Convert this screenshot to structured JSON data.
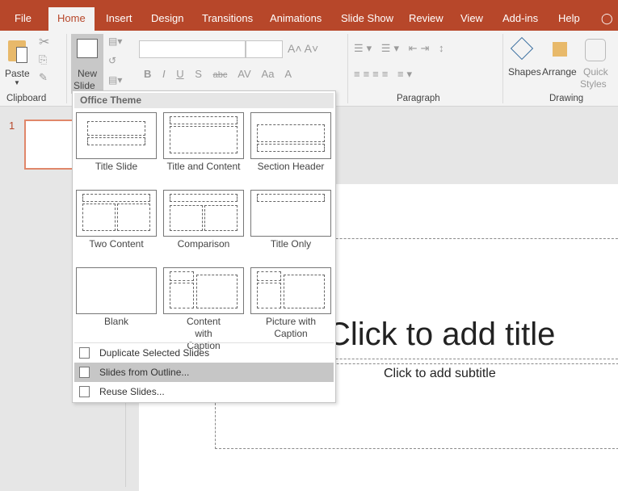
{
  "tabs": [
    "File",
    "Home",
    "Insert",
    "Design",
    "Transitions",
    "Animations",
    "Slide Show",
    "Review",
    "View",
    "Add-ins",
    "Help"
  ],
  "ribbon": {
    "paste": "Paste",
    "new": "New",
    "slide": "Slide",
    "clipboard": "Clipboard",
    "paragraph": "Paragraph",
    "drawing": "Drawing",
    "shapes": "Shapes",
    "arrange": "Arrange",
    "quick": "Quick",
    "styles": "Styles",
    "font_buttons": [
      "B",
      "I",
      "U",
      "S",
      "abc",
      "AV",
      "Aa",
      "A"
    ]
  },
  "thumbnail_number": "1",
  "menu": {
    "header": "Office Theme",
    "layouts": [
      "Title Slide",
      "Title and Content",
      "Section Header",
      "Two Content",
      "Comparison",
      "Title Only",
      "Blank",
      "Content with Caption",
      "Picture with Caption"
    ],
    "items": [
      "Duplicate Selected Slides",
      "Slides from Outline...",
      "Reuse Slides..."
    ]
  },
  "slide": {
    "title": "Click to add title",
    "subtitle": "Click to add subtitle"
  },
  "colors": {
    "accent": "#b7472a",
    "highlight": "#c6c6c6"
  }
}
